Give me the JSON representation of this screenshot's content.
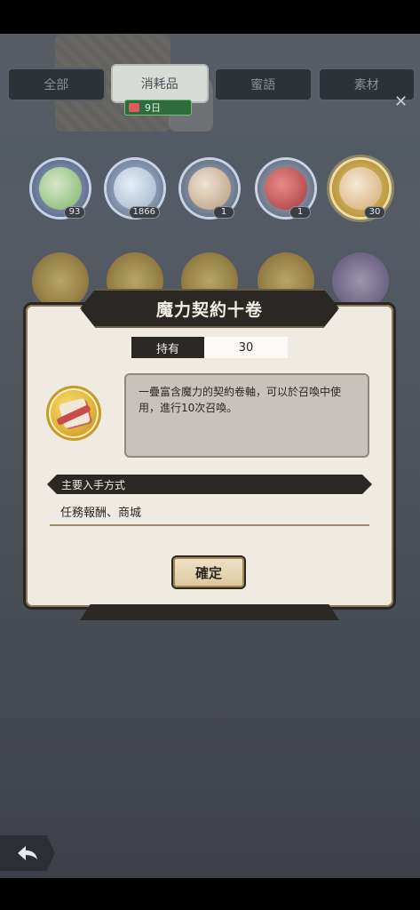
{
  "tabs": [
    {
      "label": "全部"
    },
    {
      "label": "消耗品"
    },
    {
      "label": "蜜語"
    },
    {
      "label": "素材"
    }
  ],
  "days_badge": {
    "label": "9日"
  },
  "close_icon": "close-icon",
  "items": [
    {
      "count": "93",
      "icon": "potion-icon"
    },
    {
      "count": "1866",
      "icon": "shell-icon"
    },
    {
      "count": "1",
      "icon": "scroll-fragment-icon"
    },
    {
      "count": "1",
      "icon": "red-book-icon"
    },
    {
      "count": "30",
      "icon": "contract-scroll-icon"
    }
  ],
  "dialog": {
    "title": "魔力契約十卷",
    "owned_label": "持有",
    "owned_value": "30",
    "description": "一疊富含魔力的契約卷軸，可以於召喚中使用，進行10次召喚。",
    "section_title": "主要入手方式",
    "obtain_methods": "任務報酬、商城",
    "confirm_label": "確定"
  },
  "colors": {
    "panel": "#efebe2",
    "dark": "#2b2725",
    "gold": "#e2b43a"
  }
}
